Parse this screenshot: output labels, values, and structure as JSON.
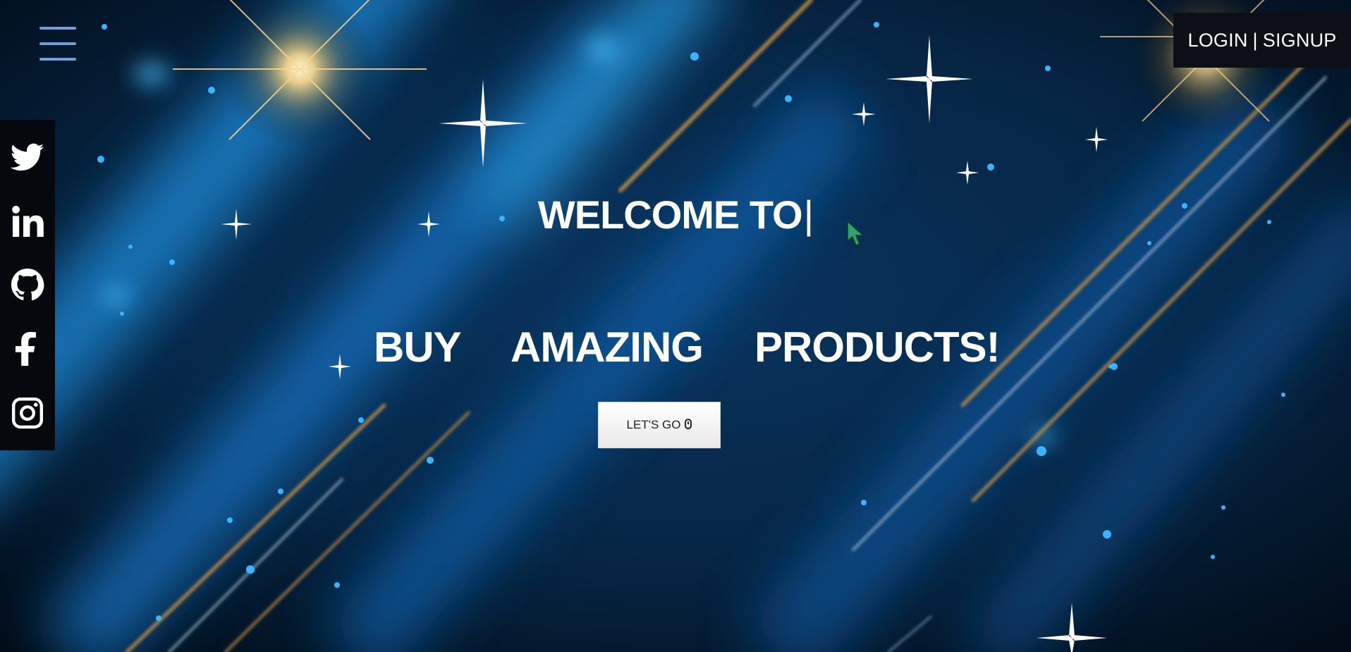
{
  "header": {
    "menu_icon": "hamburger-menu-icon",
    "login_label": "LOGIN",
    "separator": "|",
    "signup_label": "SIGNUP"
  },
  "social": {
    "items": [
      {
        "name": "twitter",
        "icon": "twitter-icon"
      },
      {
        "name": "linkedin",
        "icon": "linkedin-icon"
      },
      {
        "name": "github",
        "icon": "github-icon"
      },
      {
        "name": "facebook",
        "icon": "facebook-icon"
      },
      {
        "name": "instagram",
        "icon": "instagram-icon"
      }
    ]
  },
  "hero": {
    "welcome_text": "WELCOME TO",
    "caret": "|",
    "headline_words": [
      "BUY",
      "AMAZING",
      "PRODUCTS!"
    ],
    "cta_label": "LET'S GO",
    "cta_icon": "mouse-icon"
  },
  "colors": {
    "background": "#04111f",
    "menu_accent": "#6f9fd9",
    "auth_bg": "#0c1016",
    "social_bg": "#05090e",
    "cursor": "#2ea36b"
  }
}
